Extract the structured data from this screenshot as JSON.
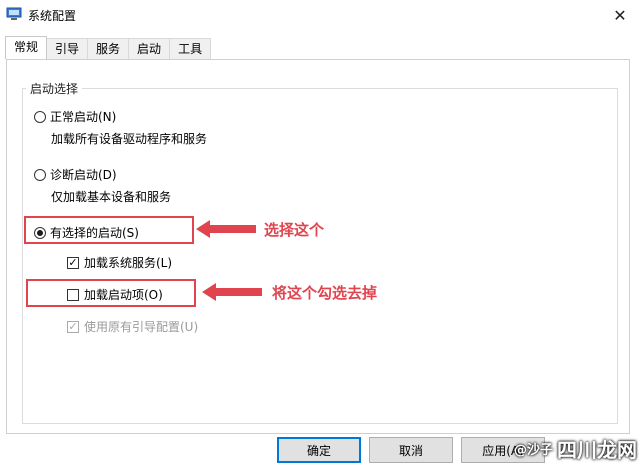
{
  "window": {
    "title": "系统配置",
    "close_glyph": "✕"
  },
  "tabs": [
    {
      "label": "常规",
      "active": true
    },
    {
      "label": "引导",
      "active": false
    },
    {
      "label": "服务",
      "active": false
    },
    {
      "label": "启动",
      "active": false
    },
    {
      "label": "工具",
      "active": false
    }
  ],
  "startup": {
    "group_label": "启动选择",
    "normal": {
      "label": "正常启动(N)",
      "desc": "加载所有设备驱动程序和服务",
      "selected": false
    },
    "diagnostic": {
      "label": "诊断启动(D)",
      "desc": "仅加载基本设备和服务",
      "selected": false
    },
    "selective": {
      "label": "有选择的启动(S)",
      "selected": true
    },
    "load_system_services": {
      "label": "加载系统服务(L)",
      "checked": true
    },
    "load_startup_items": {
      "label": "加载启动项(O)",
      "checked": false
    },
    "use_original_boot": {
      "label": "使用原有引导配置(U)",
      "checked": true,
      "disabled": true
    }
  },
  "annotations": {
    "select_this": "选择这个",
    "uncheck_this": "将这个勾选去掉",
    "color": "#e0454f"
  },
  "buttons": {
    "ok": "确定",
    "cancel": "取消",
    "apply": "应用(A)"
  },
  "watermark": {
    "text": "四川龙网",
    "sub": "@沙子"
  }
}
